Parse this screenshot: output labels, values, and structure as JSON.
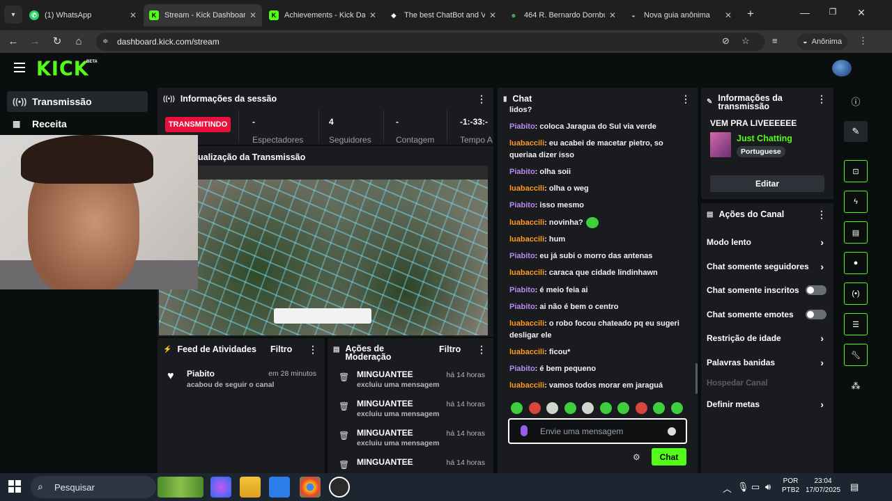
{
  "browser": {
    "tabs": [
      {
        "title": "(1) WhatsApp",
        "icon": "whatsapp-icon",
        "color": "#25d366"
      },
      {
        "title": "Stream - Kick Dashboar",
        "icon": "kick-icon",
        "color": "#53fc18"
      },
      {
        "title": "Achievements - Kick Da",
        "icon": "kick-icon",
        "color": "#53fc18"
      },
      {
        "title": "The best ChatBot and V",
        "icon": "botrix-icon",
        "color": "#ffffff"
      },
      {
        "title": "464 R. Bernardo Dornbu",
        "icon": "maps-icon",
        "color": "#34a853"
      },
      {
        "title": "Nova guia anônima",
        "icon": "incognito-icon",
        "color": "#cccccc"
      }
    ],
    "url": "dashboard.kick.com/stream",
    "incognito_label": "Anônima"
  },
  "kick": {
    "logo": "KICK",
    "beta": "BETA"
  },
  "sidebar": {
    "items": [
      {
        "label": "Transmissão",
        "icon": "broadcast-icon"
      },
      {
        "label": "Receita",
        "icon": "revenue-icon"
      }
    ]
  },
  "session": {
    "title": "Informações da sessão",
    "status": "TRANSMITINDO",
    "stats": [
      {
        "value": "-",
        "label": "Espectadores"
      },
      {
        "value": "4",
        "label": "Seguidores"
      },
      {
        "value": "-",
        "label": "Contagem"
      },
      {
        "value": "-1:-33:-",
        "label": "Tempo A"
      }
    ]
  },
  "preview": {
    "title": "ualização da Transmissão"
  },
  "activity": {
    "title": "Feed de Atividades",
    "filter": "Filtro",
    "items": [
      {
        "user": "Piabito",
        "time": "em 28 minutos",
        "action": "acabou de seguir o canal"
      }
    ]
  },
  "moderation": {
    "title": "Ações de Moderação",
    "filter": "Filtro",
    "items": [
      {
        "user": "MINGUANTEE",
        "action": "excluiu uma mensagem",
        "time": "há 14 horas"
      },
      {
        "user": "MINGUANTEE",
        "action": "excluiu uma mensagem",
        "time": "há 14 horas"
      },
      {
        "user": "MINGUANTEE",
        "action": "excluiu uma mensagem",
        "time": "há 14 horas"
      },
      {
        "user": "MINGUANTEE",
        "action": "",
        "time": "há 14 horas"
      }
    ]
  },
  "chat": {
    "title": "Chat",
    "messages": [
      {
        "user": "",
        "text": "lidos?",
        "cls": ""
      },
      {
        "user": "Piabito",
        "text": "coloca Jaragua do Sul via verde",
        "cls": "u1"
      },
      {
        "user": "luabaccili",
        "text": "eu acabei de macetar pietro, so queriaa dizer isso",
        "cls": "u2"
      },
      {
        "user": "Piabito",
        "text": "olha soii",
        "cls": "u1"
      },
      {
        "user": "luabaccili",
        "text": "olha o weg",
        "cls": "u2"
      },
      {
        "user": "Piabito",
        "text": "isso mesmo",
        "cls": "u1"
      },
      {
        "user": "luabaccili",
        "text": "novinha?",
        "cls": "u2"
      },
      {
        "user": "luabaccili",
        "text": "hum",
        "cls": "u2"
      },
      {
        "user": "Piabito",
        "text": "eu já subi o morro das antenas",
        "cls": "u1"
      },
      {
        "user": "luabaccili",
        "text": "caraca que cidade lindinhawn",
        "cls": "u2"
      },
      {
        "user": "Piabito",
        "text": "é meio feia ai",
        "cls": "u1"
      },
      {
        "user": "Piabito",
        "text": "ai não é bem o centro",
        "cls": "u1"
      },
      {
        "user": "luabaccili",
        "text": "o robo focou chateado pq eu sugeri desligar ele",
        "cls": "u2"
      },
      {
        "user": "luabaccili",
        "text": "ficou*",
        "cls": "u2"
      },
      {
        "user": "Piabito",
        "text": "é bem pequeno",
        "cls": "u1"
      },
      {
        "user": "luabaccili",
        "text": "vamos todos morar em jaraguá",
        "cls": "u2"
      }
    ],
    "placeholder": "Envie uma mensagem",
    "send": "Chat"
  },
  "stream_info": {
    "title": "Informações da transmissão",
    "stream_title": "VEM PRA LIVEEEEEE",
    "category": "Just Chatting",
    "language": "Portuguese",
    "edit": "Editar"
  },
  "channel_actions": {
    "title": "Ações do Canal",
    "items": [
      {
        "label": "Modo lento",
        "control": "chevron"
      },
      {
        "label": "Chat somente seguidores",
        "control": "chevron"
      },
      {
        "label": "Chat somente inscritos",
        "control": "toggle"
      },
      {
        "label": "Chat somente emotes",
        "control": "toggle"
      },
      {
        "label": "Restrição de idade",
        "control": "chevron"
      },
      {
        "label": "Palavras banidas",
        "control": "chevron"
      },
      {
        "label": "Hospedar Canal",
        "control": "none"
      },
      {
        "label": "Definir metas",
        "control": "chevron"
      }
    ]
  },
  "taskbar": {
    "search": "Pesquisar",
    "lang": "POR",
    "layout": "PTB2",
    "time": "23:04",
    "date": "17/07/2025"
  },
  "colors": {
    "accent": "#53fc18",
    "live": "#e9113c",
    "purple": "#b48cf2",
    "orange": "#ff9a1f"
  }
}
